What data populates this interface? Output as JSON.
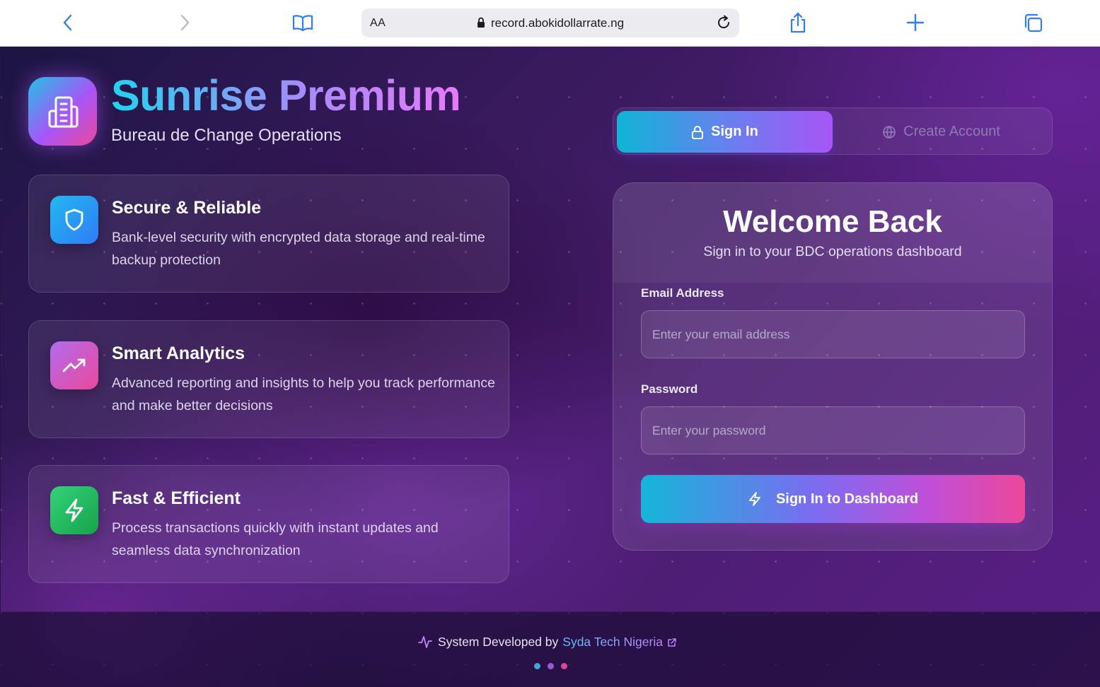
{
  "browser": {
    "reader_label": "AA",
    "url": "record.abokidollarrate.ng"
  },
  "brand": {
    "title": "Sunrise Premium",
    "subtitle": "Bureau de Change Operations"
  },
  "features": [
    {
      "title": "Secure & Reliable",
      "description": "Bank-level security with encrypted data storage and real-time backup protection",
      "icon": "shield-icon",
      "color": "#1fa7f0"
    },
    {
      "title": "Smart Analytics",
      "description": "Advanced reporting and insights to help you track performance and make better decisions",
      "icon": "trending-up-icon",
      "color": "#d35ce0"
    },
    {
      "title": "Fast & Efficient",
      "description": "Process transactions quickly with instant updates and seamless data synchronization",
      "icon": "lightning-icon",
      "color": "#22c55e"
    }
  ],
  "tabs": {
    "sign_in": "Sign In",
    "create_account": "Create Account"
  },
  "login": {
    "title": "Welcome Back",
    "subtitle": "Sign in to your BDC operations dashboard",
    "email_label": "Email Address",
    "email_placeholder": "Enter your email address",
    "password_label": "Password",
    "password_placeholder": "Enter your password",
    "submit_label": "Sign In to Dashboard"
  },
  "footer": {
    "credit_prefix": "System Developed by",
    "credit_link": "Syda Tech Nigeria"
  },
  "colors": {
    "accent_cyan": "#14b6d8",
    "accent_purple": "#a855f7",
    "accent_pink": "#ec4899"
  }
}
